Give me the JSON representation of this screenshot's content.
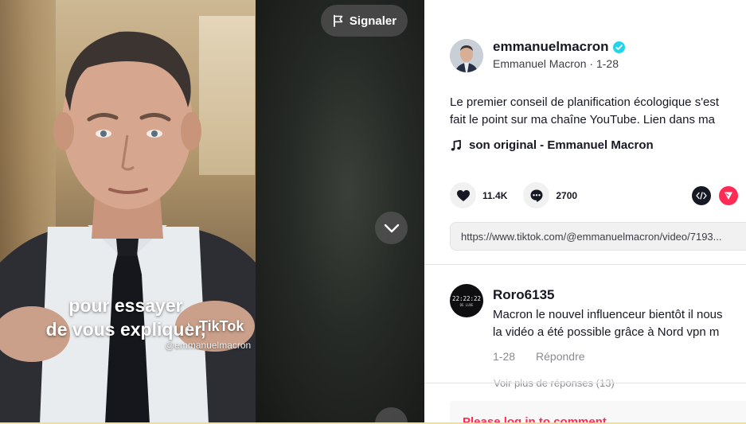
{
  "video": {
    "caption_line1": "pour essayer",
    "caption_line2": "de vous expliquer,",
    "watermark_brand": "TikTok",
    "watermark_handle": "@emmanuelmacron",
    "report_label": "Signaler"
  },
  "author": {
    "username": "emmanuelmacron",
    "display_name": "Emmanuel Macron",
    "separator": " · ",
    "date": "1-28"
  },
  "description": {
    "line1": "Le premier conseil de planification écologique s'est",
    "line2": "fait le point sur ma chaîne YouTube. Lien dans ma"
  },
  "music": {
    "label": "son original - Emmanuel Macron"
  },
  "actions": {
    "likes": "11.4K",
    "comments": "2700"
  },
  "share": {
    "url": "https://www.tiktok.com/@emmanuelmacron/video/7193..."
  },
  "comment": {
    "avatar_text": "22:22:22",
    "avatar_subtext": "DE LUXE",
    "username": "Roro6135",
    "line1": "Macron le nouvel influenceur bientôt il nous",
    "line2": "la vidéo a été possible grâce à Nord vpn m",
    "date": "1-28",
    "reply_label": "Répondre",
    "more_replies": "Voir plus de réponses (13)"
  },
  "login": {
    "label": "Please log in to comment"
  },
  "colors": {
    "brand_red": "#fe2c55",
    "verified_blue": "#20d5ec",
    "text_primary": "#161823"
  },
  "icons": [
    "flag-icon",
    "chevron-down-icon",
    "verified-icon",
    "music-note-icon",
    "heart-icon",
    "comment-icon",
    "embed-icon",
    "send-icon",
    "tiktok-logo-icon"
  ]
}
